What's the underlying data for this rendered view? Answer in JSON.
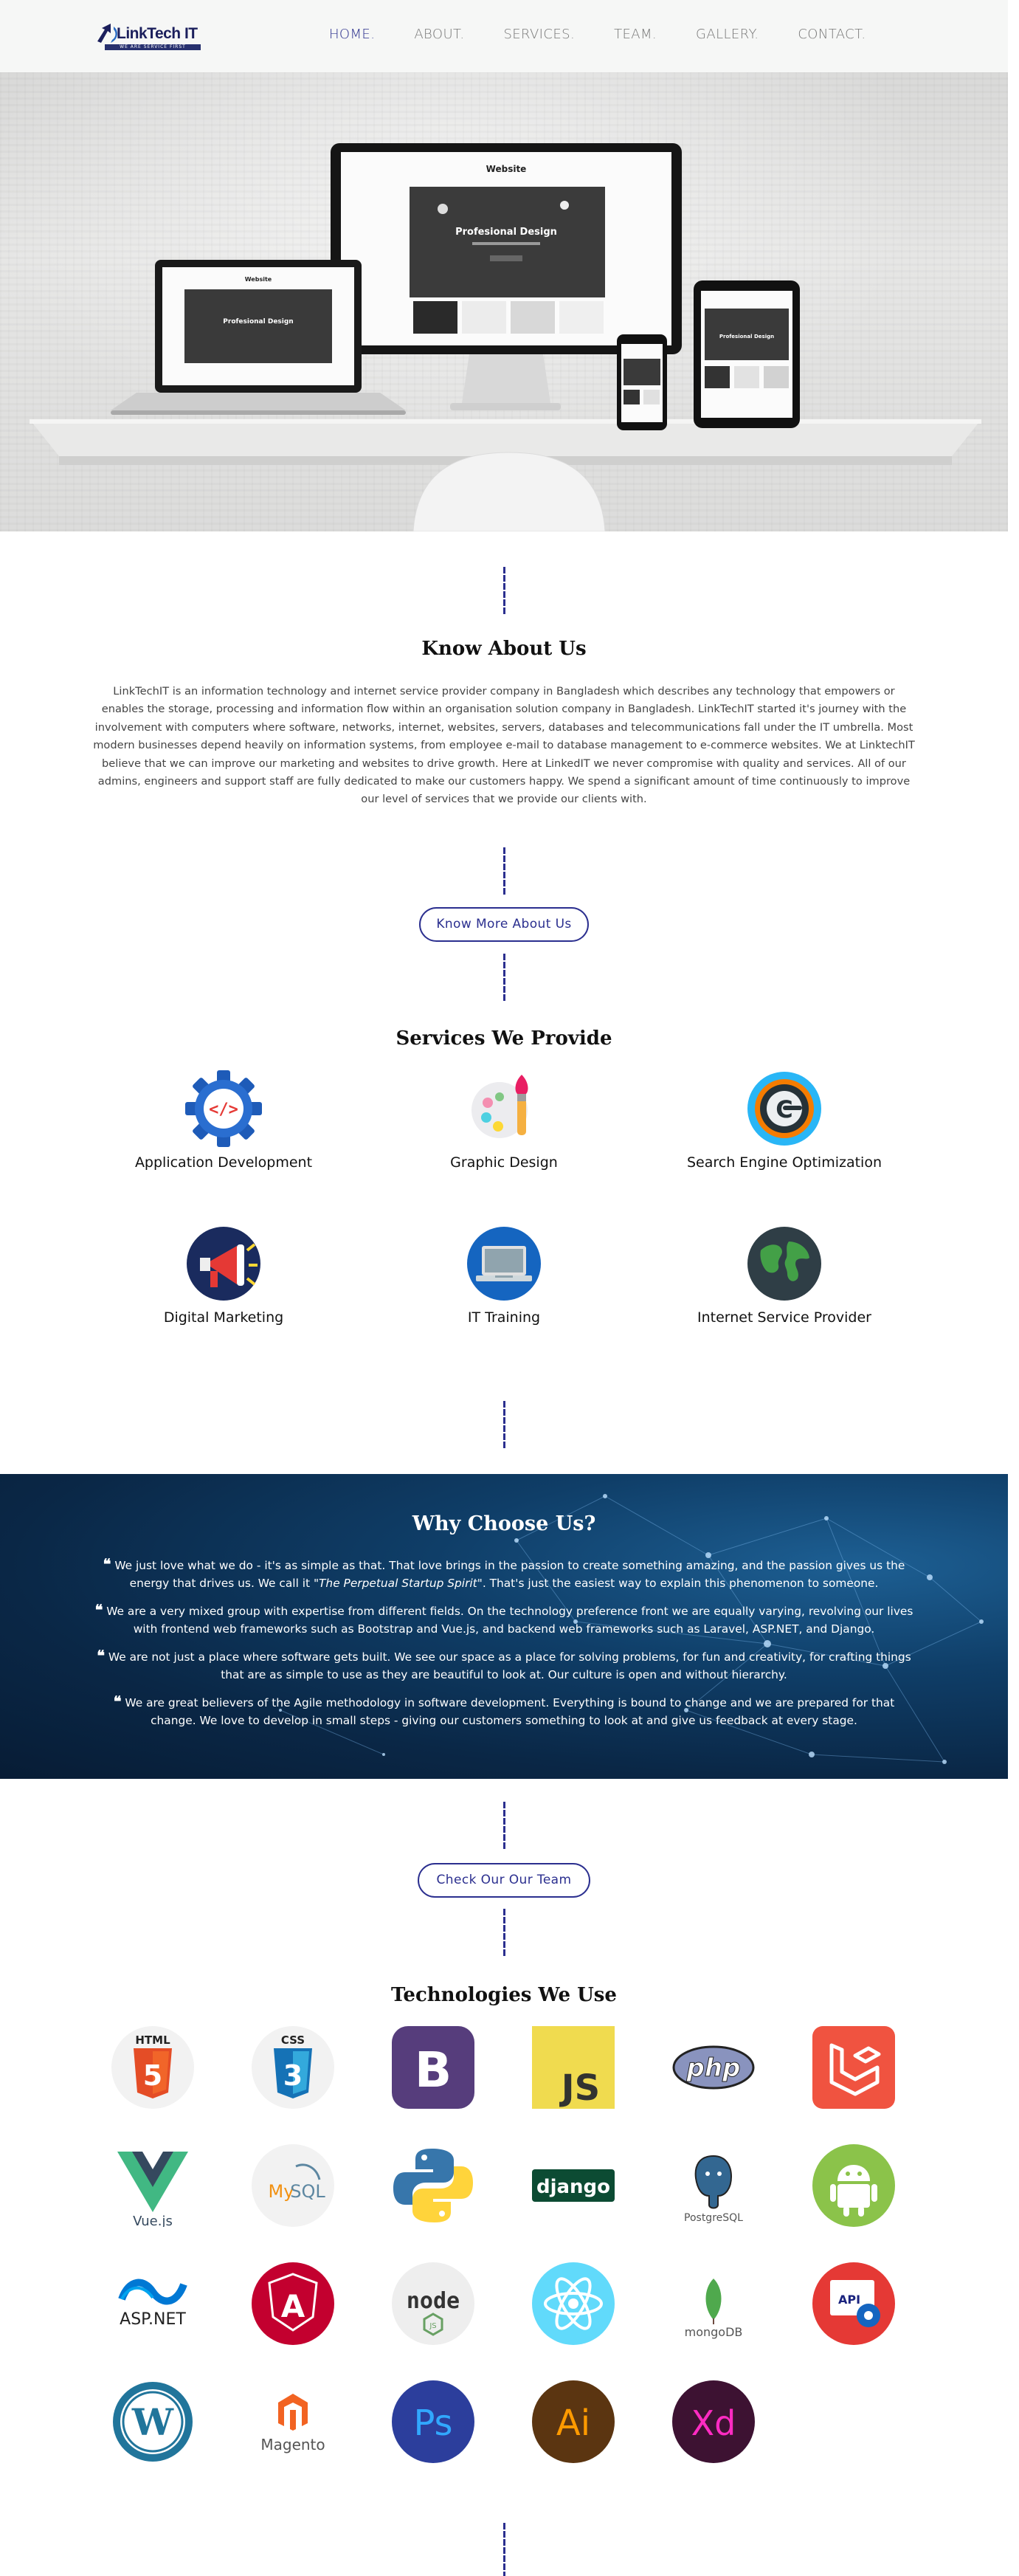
{
  "nav": {
    "logo_text": "LinkTech IT",
    "logo_tagline": "WE ARE SERVICE FIRST",
    "links": [
      "HOME.",
      "ABOUT.",
      "SERVICES.",
      "TEAM.",
      "GALLERY.",
      "CONTACT."
    ],
    "active": "HOME."
  },
  "hero": {
    "screen_title": "Website",
    "screen_headline": "Profesional Design"
  },
  "about": {
    "title": "Know About Us",
    "text": "LinkTechIT is an information technology and internet service provider company in Bangladesh which describes any technology that empowers or enables the storage, processing and information flow within an organisation solution company in Bangladesh. LinkTechIT started it's journey with the involvement with computers where software, networks, internet, websites, servers, databases and telecommunications fall under the IT umbrella. Most modern businesses depend heavily on information systems, from employee e-mail to database management to e-commerce websites. We at LinktechIT believe that we can improve our marketing and websites to drive growth. Here at LinkedIT we never compromise with quality and services. All of our admins, engineers and support staff are fully dedicated to make our customers happy. We spend a significant amount of time continuously to improve our level of services that we provide our clients with.",
    "button": "Know More About Us"
  },
  "services": {
    "title": "Services We Provide",
    "items": [
      {
        "label": "Application Development",
        "icon": "gear-code-icon"
      },
      {
        "label": "Graphic Design",
        "icon": "palette-brush-icon"
      },
      {
        "label": "Search Engine Optimization",
        "icon": "seo-gauge-icon"
      },
      {
        "label": "Digital Marketing",
        "icon": "megaphone-icon"
      },
      {
        "label": "IT Training",
        "icon": "laptop-icon"
      },
      {
        "label": "Internet Service Provider",
        "icon": "globe-icon"
      }
    ]
  },
  "why": {
    "title": "Why Choose Us?",
    "items": [
      {
        "pre": "We just love what we do - it's as simple as that. That love brings in the passion to create something amazing, and the passion gives us the energy that drives us. We call it ",
        "em": "\"The Perpetual Startup Spirit\"",
        "post": ". That's just the easiest way to explain this phenomenon to someone."
      },
      {
        "pre": "We are a very mixed group with expertise from different fields. On the technology preference front we are equally varying, revolving our lives with frontend web frameworks such as Bootstrap and Vue.js, and backend web frameworks such as Laravel, ASP.NET, and Django.",
        "em": "",
        "post": ""
      },
      {
        "pre": "We are not just a place where software gets built. We see our space as a place for solving problems, for fun and creativity, for crafting things that are as simple to use as they are beautiful to look at. Our culture is open and without hierarchy.",
        "em": "",
        "post": ""
      },
      {
        "pre": "We are great believers of the Agile methodology in software development. Everything is bound to change and we are prepared for that change. We love to develop in small steps - giving our customers something to look at and give us feedback at every stage.",
        "em": "",
        "post": ""
      }
    ]
  },
  "team_button": "Check Our Our Team",
  "tech": {
    "title": "Technologies We Use",
    "logos": [
      {
        "name": "html5-icon",
        "text": "HTML"
      },
      {
        "name": "css3-icon",
        "text": "CSS"
      },
      {
        "name": "bootstrap-icon",
        "text": "B"
      },
      {
        "name": "javascript-icon",
        "text": "JS"
      },
      {
        "name": "php-icon",
        "text": "php"
      },
      {
        "name": "laravel-icon",
        "text": ""
      },
      {
        "name": "vuejs-icon",
        "text": "Vue.js"
      },
      {
        "name": "mysql-icon",
        "text": "MySQL"
      },
      {
        "name": "python-icon",
        "text": ""
      },
      {
        "name": "django-icon",
        "text": "django"
      },
      {
        "name": "postgresql-icon",
        "text": "PostgreSQL"
      },
      {
        "name": "android-icon",
        "text": ""
      },
      {
        "name": "aspnet-icon",
        "text": "ASP.NET"
      },
      {
        "name": "angular-icon",
        "text": "A"
      },
      {
        "name": "nodejs-icon",
        "text": "node"
      },
      {
        "name": "react-icon",
        "text": ""
      },
      {
        "name": "mongodb-icon",
        "text": "mongoDB"
      },
      {
        "name": "api-icon",
        "text": "API"
      },
      {
        "name": "wordpress-icon",
        "text": "W"
      },
      {
        "name": "magento-icon",
        "text": "Magento"
      },
      {
        "name": "photoshop-icon",
        "text": "Ps"
      },
      {
        "name": "illustrator-icon",
        "text": "Ai"
      },
      {
        "name": "adobe-xd-icon",
        "text": "Xd"
      }
    ]
  },
  "colors": {
    "accent": "#2b2f8f",
    "nav_bg": "#f6f7f6",
    "why_bg": "#0a2746"
  }
}
